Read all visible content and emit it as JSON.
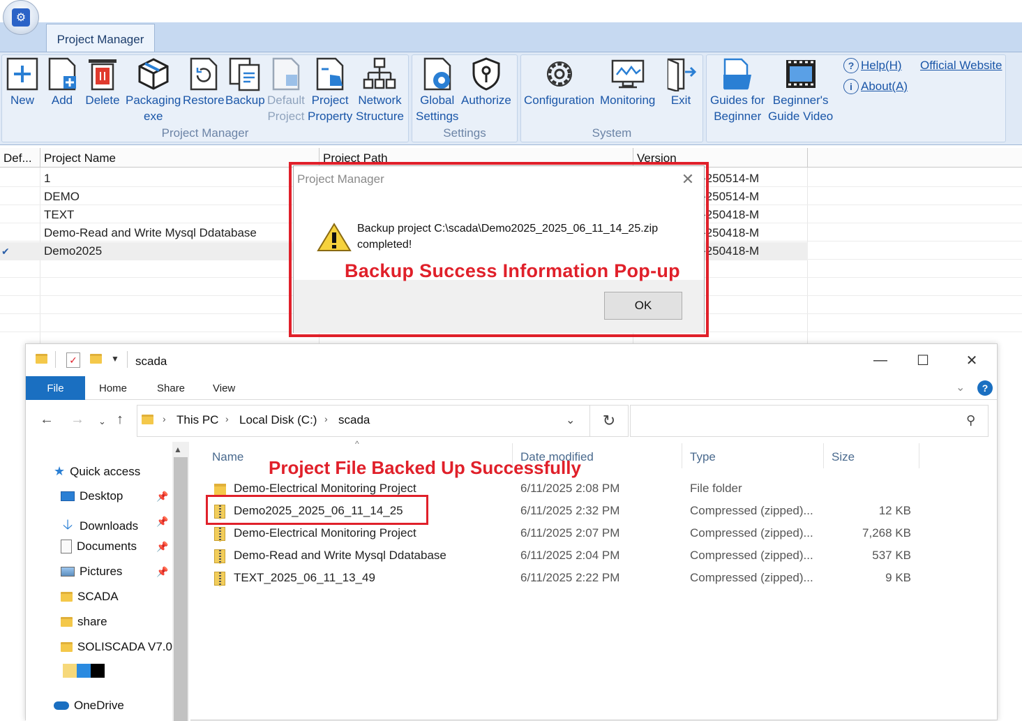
{
  "ribbon": {
    "tab": "Project Manager",
    "groups": {
      "project_manager": "Project Manager",
      "settings": "Settings",
      "system": "System"
    },
    "buttons": {
      "new": "New",
      "add": "Add",
      "delete": "Delete",
      "packaging_1": "Packaging",
      "packaging_2": "exe",
      "restore": "Restore",
      "backup": "Backup",
      "default_1": "Default",
      "default_2": "Project",
      "property_1": "Project",
      "property_2": "Property",
      "network_1": "Network",
      "network_2": "Structure",
      "global_1": "Global",
      "global_2": "Settings",
      "authorize": "Authorize",
      "configuration": "Configuration",
      "monitoring": "Monitoring",
      "exit": "Exit",
      "guides_1": "Guides for",
      "guides_2": "Beginner",
      "video_1": "Beginner's",
      "video_2": "Guide Video"
    },
    "help": "Help(H)",
    "about": "About(A)",
    "official_website": "Official Website"
  },
  "grid": {
    "headers": [
      "Def...",
      "Project Name",
      "Project Path",
      "Version"
    ],
    "rows": [
      {
        "name": "1",
        "version": "-250514-M"
      },
      {
        "name": "DEMO",
        "version": "-250514-M"
      },
      {
        "name": "TEXT",
        "version": "-250418-M"
      },
      {
        "name": "Demo-Read and Write Mysql Ddatabase",
        "version": "-250418-M"
      },
      {
        "name": "Demo2025",
        "version": "-250418-M",
        "default": "✔"
      }
    ]
  },
  "dialog": {
    "title": "Project Manager",
    "message_line1": "Backup project C:\\scada\\Demo2025_2025_06_11_14_25.zip",
    "message_line2": "completed!",
    "ok": "OK",
    "annotation": "Backup Success Information Pop-up"
  },
  "explorer": {
    "title": "scada",
    "tabs": [
      "File",
      "Home",
      "Share",
      "View"
    ],
    "breadcrumb": [
      "This PC",
      "Local Disk (C:)",
      "scada"
    ],
    "nav": {
      "quick_access": "Quick access",
      "items": [
        "Desktop",
        "Downloads",
        "Documents",
        "Pictures",
        "SCADA",
        "share",
        "SOLISCADA V7.0"
      ],
      "onedrive": "OneDrive"
    },
    "columns": [
      "Name",
      "Date modified",
      "Type",
      "Size"
    ],
    "files": [
      {
        "name": "Demo-Electrical Monitoring Project",
        "date": "6/11/2025 2:08 PM",
        "type": "File folder",
        "size": ""
      },
      {
        "name": "Demo2025_2025_06_11_14_25",
        "date": "6/11/2025 2:32 PM",
        "type": "Compressed (zipped)...",
        "size": "12 KB"
      },
      {
        "name": "Demo-Electrical Monitoring Project",
        "date": "6/11/2025 2:07 PM",
        "type": "Compressed (zipped)...",
        "size": "7,268 KB"
      },
      {
        "name": "Demo-Read and Write Mysql Ddatabase",
        "date": "6/11/2025 2:04 PM",
        "type": "Compressed (zipped)...",
        "size": "537 KB"
      },
      {
        "name": "TEXT_2025_06_11_13_49",
        "date": "6/11/2025 2:22 PM",
        "type": "Compressed (zipped)...",
        "size": "9 KB"
      }
    ],
    "annotation": "Project File Backed Up Successfully"
  },
  "colors": {
    "annotation_red": "#e0202a",
    "ribbon_blue": "#1a56a8",
    "file_tab_blue": "#1a6fc1"
  }
}
